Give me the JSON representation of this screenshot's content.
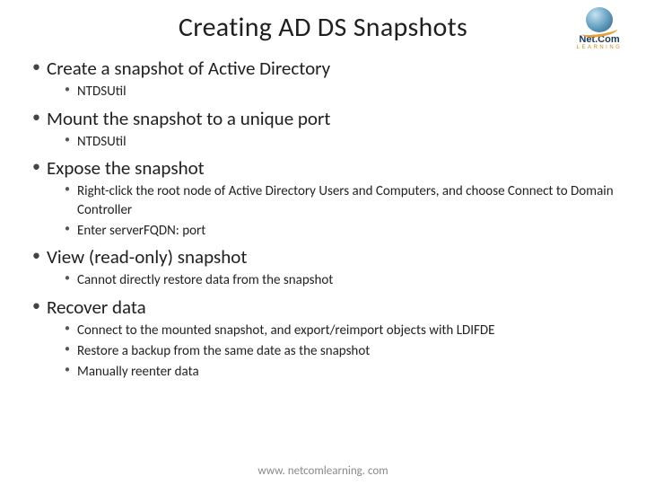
{
  "title": "Creating AD DS Snapshots",
  "logo": {
    "line1": "Net.Com",
    "line2": "LEARNING"
  },
  "bullets": {
    "b1": "Create a snapshot of Active Directory",
    "b1_1": "NTDSUtil",
    "b2": "Mount the snapshot to a unique port",
    "b2_1": "NTDSUtil",
    "b3": "Expose the snapshot",
    "b3_1": "Right-click the root node of Active Directory Users and Computers, and choose Connect to Domain Controller",
    "b3_2": "Enter serverFQDN: port",
    "b4": "View (read-only) snapshot",
    "b4_1": "Cannot directly restore data from the snapshot",
    "b5": "Recover data",
    "b5_1": "Connect to the mounted snapshot, and export/reimport objects with LDIFDE",
    "b5_2": "Restore a backup from the same date as the snapshot",
    "b5_3": "Manually reenter data"
  },
  "footer": "www. netcomlearning. com"
}
